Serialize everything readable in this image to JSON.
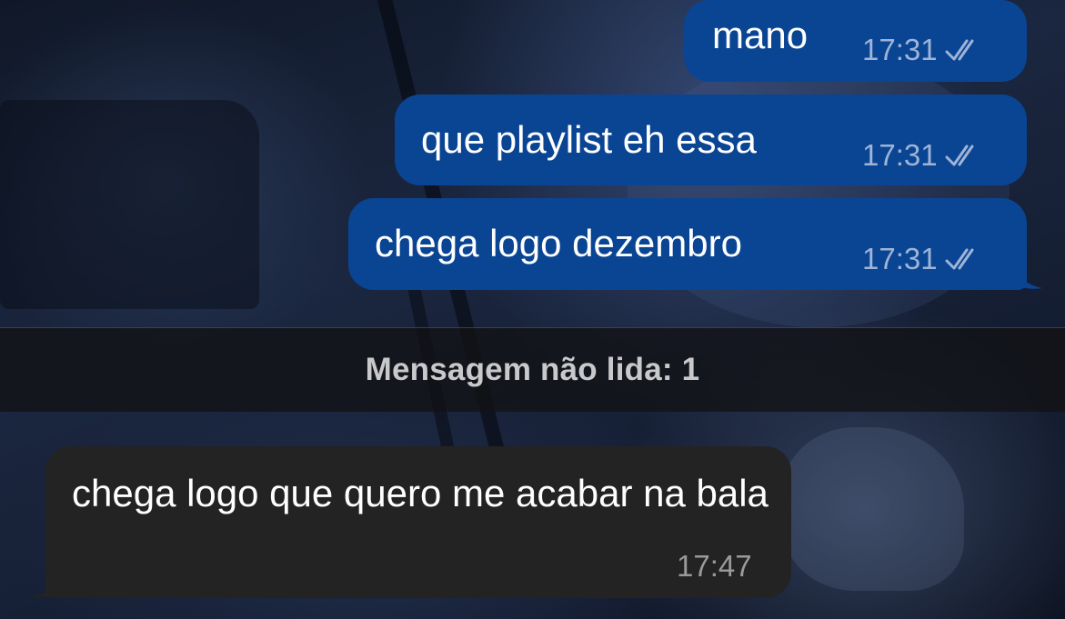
{
  "colors": {
    "outgoing_bubble": "#0a4594",
    "incoming_bubble": "#232323",
    "timestamp_out": "#9fb4d6",
    "timestamp_in": "#9a9a9a"
  },
  "messages": [
    {
      "direction": "outgoing",
      "text": "mano",
      "time": "17:31",
      "status_icon": "double-check-icon"
    },
    {
      "direction": "outgoing",
      "text": "que playlist eh essa",
      "time": "17:31",
      "status_icon": "double-check-icon"
    },
    {
      "direction": "outgoing",
      "text": "chega logo dezembro",
      "time": "17:31",
      "status_icon": "double-check-icon"
    },
    {
      "direction": "incoming",
      "text": "chega logo que quero me acabar na bala",
      "time": "17:47"
    }
  ],
  "unread_divider": {
    "label": "Mensagem não lida: 1"
  }
}
